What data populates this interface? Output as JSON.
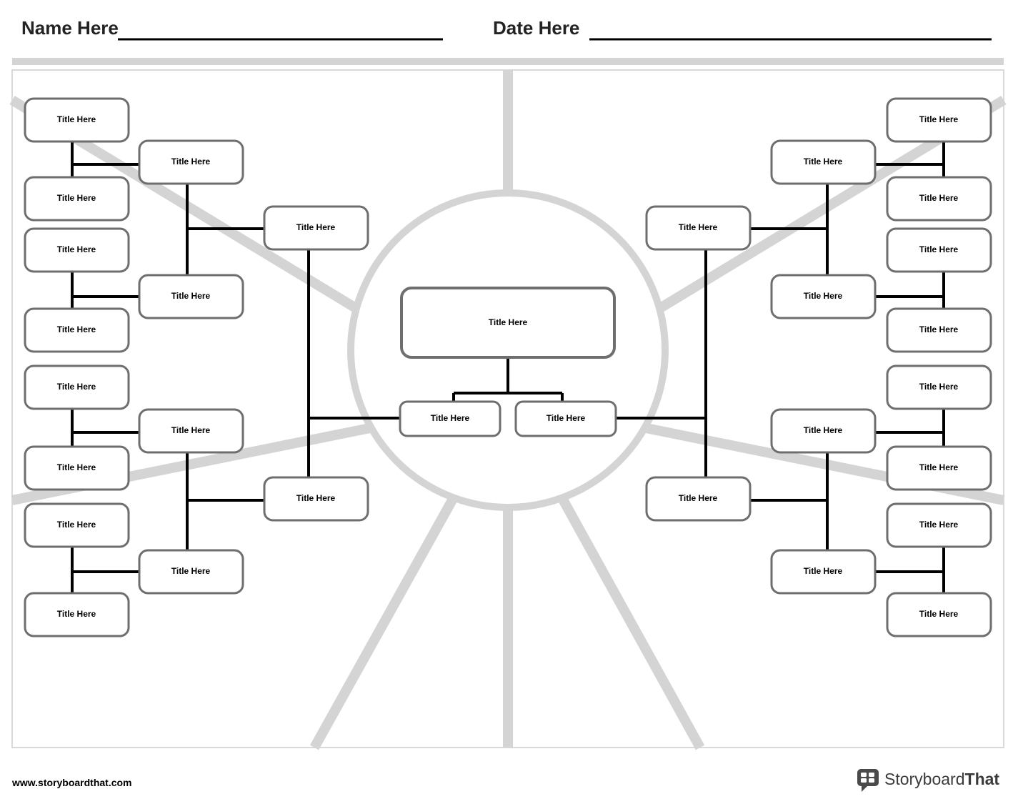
{
  "header": {
    "name_label": "Name Here",
    "date_label": "Date Here"
  },
  "footer": {
    "url": "www.storyboardthat.com",
    "brand_a": "Storyboard",
    "brand_b": "That"
  },
  "center": {
    "main": "Title Here",
    "child_left": "Title Here",
    "child_right": "Title Here"
  },
  "semi_left": {
    "upper": "Title Here",
    "lower": "Title Here"
  },
  "semi_right": {
    "upper": "Title Here",
    "lower": "Title Here"
  },
  "left_col_inner": {
    "a": "Title Here",
    "b": "Title Here",
    "c": "Title Here",
    "d": "Title Here"
  },
  "right_col_inner": {
    "a": "Title Here",
    "b": "Title Here",
    "c": "Title Here",
    "d": "Title Here"
  },
  "left_outer": {
    "a": "Title Here",
    "b": "Title Here",
    "c": "Title Here",
    "d": "Title Here",
    "e": "Title Here",
    "f": "Title Here",
    "g": "Title Here",
    "h": "Title Here"
  },
  "right_outer": {
    "a": "Title Here",
    "b": "Title Here",
    "c": "Title Here",
    "d": "Title Here",
    "e": "Title Here",
    "f": "Title Here",
    "g": "Title Here",
    "h": "Title Here"
  },
  "colors": {
    "ray": "#d4d4d4",
    "box_stroke": "#6e6e6e",
    "line": "#000"
  }
}
